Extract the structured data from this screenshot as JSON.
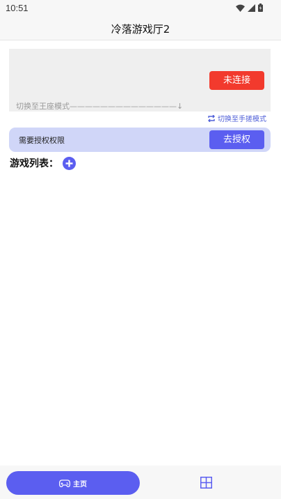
{
  "status_bar": {
    "time": "10:51",
    "icons": [
      "wifi-icon",
      "signal-icon",
      "battery-icon"
    ]
  },
  "app_bar": {
    "title": "冷落游戏厅2"
  },
  "device_panel": {
    "connect_button_label": "未连接",
    "switch_hint": "切换至王座模式——————————————↓"
  },
  "mode_switch": {
    "icon": "swap-icon",
    "label": "切换至手搓模式"
  },
  "auth": {
    "message": "需要授权权限",
    "button_label": "去授权"
  },
  "games": {
    "title": "游戏列表：",
    "add_icon": "plus-circle-icon"
  },
  "bottom_nav": {
    "tabs": [
      {
        "label": "主页",
        "icon": "gamepad-icon",
        "active": true
      },
      {
        "label": "",
        "icon": "grid-icon",
        "active": false
      }
    ]
  },
  "colors": {
    "accent": "#5b5ef0",
    "danger": "#f23a2d",
    "auth_bg": "#d0d6f8",
    "panel_bg": "#efefef"
  }
}
